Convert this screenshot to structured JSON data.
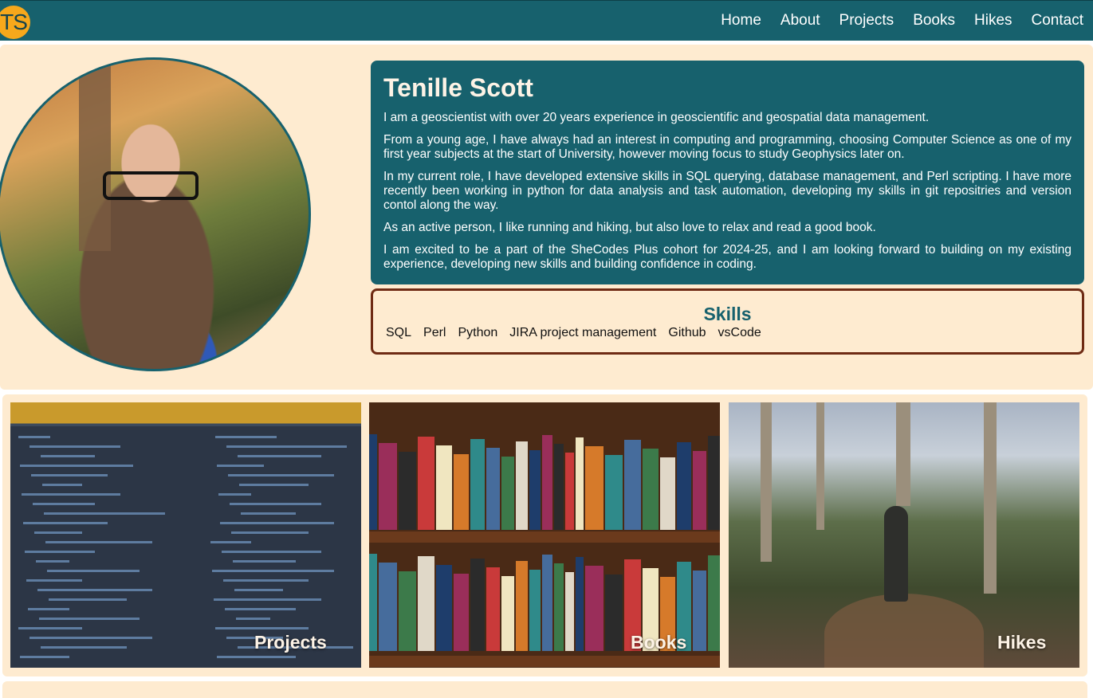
{
  "header": {
    "logo_text": "TS",
    "nav": [
      "Home",
      "About",
      "Projects",
      "Books",
      "Hikes",
      "Contact"
    ]
  },
  "profile": {
    "name": "Tenille Scott",
    "paragraphs": [
      "I am a geoscientist with over 20 years experience in geoscientific and geospatial data management.",
      "From a young age, I have always had an interest in computing and programming, choosing Computer Science as one of my first year subjects at the start of University, however moving focus to study Geophysics later on.",
      "In my current role, I have developed extensive skills in SQL querying, database management, and Perl scripting. I have more recently been working in python for data analysis and task automation, developing my skills in git repositries and version contol along the way.",
      "As an active person, I like running and hiking, but also love to relax and read a good book.",
      "I am excited to be a part of the SheCodes Plus cohort for 2024-25, and I am looking forward to building on my existing experience, developing new skills and building confidence in coding."
    ]
  },
  "skills": {
    "title": "Skills",
    "items": [
      "SQL",
      "Perl",
      "Python",
      "JIRA project management",
      "Github",
      "vsCode"
    ]
  },
  "gallery": {
    "tiles": [
      {
        "label": "Projects"
      },
      {
        "label": "Books"
      },
      {
        "label": "Hikes"
      }
    ]
  },
  "colors": {
    "nav_bg": "#17616d",
    "card_bg": "#feebd0",
    "accent": "#f7a81b",
    "skills_border": "#6f2b14"
  }
}
